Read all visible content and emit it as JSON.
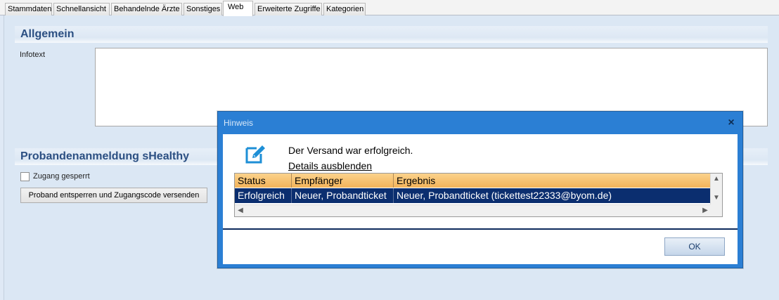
{
  "tabs": [
    {
      "label": "Stammdaten"
    },
    {
      "label": "Schnellansicht"
    },
    {
      "label": "Behandelnde Ärzte"
    },
    {
      "label": "Sonstiges"
    },
    {
      "label": "Web"
    },
    {
      "label": "Erweiterte Zugriffe"
    },
    {
      "label": "Kategorien"
    }
  ],
  "active_tab": "Web",
  "section_allgemein": {
    "title": "Allgemein",
    "infotext_label": "Infotext",
    "infotext_value": ""
  },
  "section_probanden": {
    "title": "Probandenanmeldung sHealthy",
    "checkbox_label": "Zugang gesperrt",
    "checkbox_checked": false,
    "button_label": "Proband entsperren und Zugangscode versenden"
  },
  "dialog": {
    "title": "Hinweis",
    "close_glyph": "×",
    "message": "Der Versand war erfolgreich.",
    "details_link": "Details ausblenden",
    "table": {
      "columns": [
        "Status",
        "Empfänger",
        "Ergebnis"
      ],
      "rows": [
        [
          "Erfolgreich",
          "Neuer, Probandticket",
          "Neuer, Probandticket (tickettest22333@byom.de)"
        ]
      ]
    },
    "ok_label": "OK"
  },
  "colors": {
    "dialog_titlebar": "#2b7fd4",
    "selected_row": "#0b2e6f",
    "header_gradient": "#f3b35a",
    "section_title": "#2b4f82"
  }
}
